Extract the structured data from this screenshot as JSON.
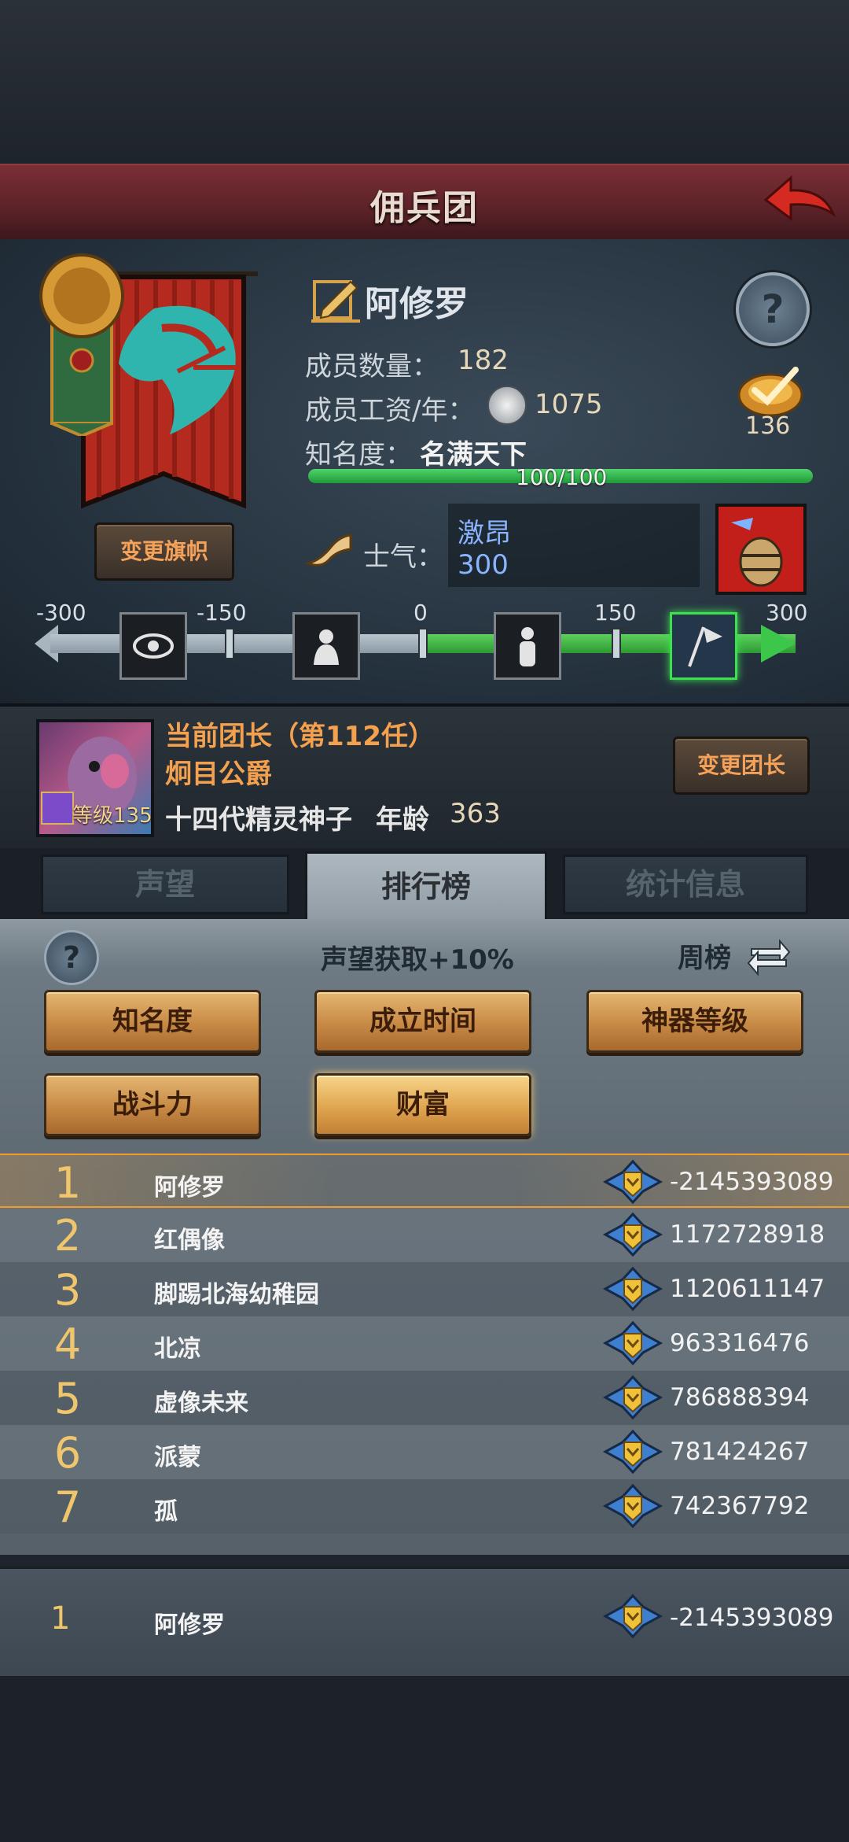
{
  "header": {
    "title": "佣兵团"
  },
  "guild": {
    "name": "阿修罗",
    "member_count_label": "成员数量：",
    "member_count": "182",
    "salary_label": "成员工资/年：",
    "salary": "1075",
    "fame_label": "知名度：",
    "fame_value": "名满天下",
    "fame_progress": "100/100",
    "fame_fraction": 1.0,
    "badge_count": "136",
    "change_banner_label": "变更旗帜",
    "morale_label": "士气：",
    "morale_state": "激昂",
    "morale_value": "300"
  },
  "morale_scale": {
    "ticks": [
      "-300",
      "-150",
      "0",
      "150",
      "300"
    ],
    "current": 300,
    "min": -300,
    "max": 300
  },
  "leader": {
    "title": "当前团长（第112任）",
    "name": "炯目公爵",
    "level_label": "等级135",
    "race": "十四代精灵神子",
    "age_label": "年龄",
    "age": "363",
    "change_leader_label": "变更团长"
  },
  "tabs": [
    {
      "label": "声望",
      "active": false
    },
    {
      "label": "排行榜",
      "active": true
    },
    {
      "label": "统计信息",
      "active": false
    }
  ],
  "ranking": {
    "bonus_text": "声望获取+10%",
    "period_label": "周榜",
    "categories": [
      "知名度",
      "成立时间",
      "神器等级",
      "战斗力",
      "财富"
    ],
    "selected_category": "财富",
    "rows": [
      {
        "rank": "1",
        "name": "阿修罗",
        "value": "-2145393089"
      },
      {
        "rank": "2",
        "name": "红偶像",
        "value": "1172728918"
      },
      {
        "rank": "3",
        "name": "脚踢北海幼稚园",
        "value": "1120611147"
      },
      {
        "rank": "4",
        "name": "北凉",
        "value": "963316476"
      },
      {
        "rank": "5",
        "name": "虚像未来",
        "value": "786888394"
      },
      {
        "rank": "6",
        "name": "派蒙",
        "value": "781424267"
      },
      {
        "rank": "7",
        "name": "孤",
        "value": "742367792"
      }
    ],
    "my_row": {
      "rank": "1",
      "name": "阿修罗",
      "value": "-2145393089"
    }
  },
  "colors": {
    "accent_gold": "#f0c66d",
    "title_bar": "#5a2228",
    "morale_green": "#2d9a33",
    "fame_bar": "#2fb14a"
  }
}
